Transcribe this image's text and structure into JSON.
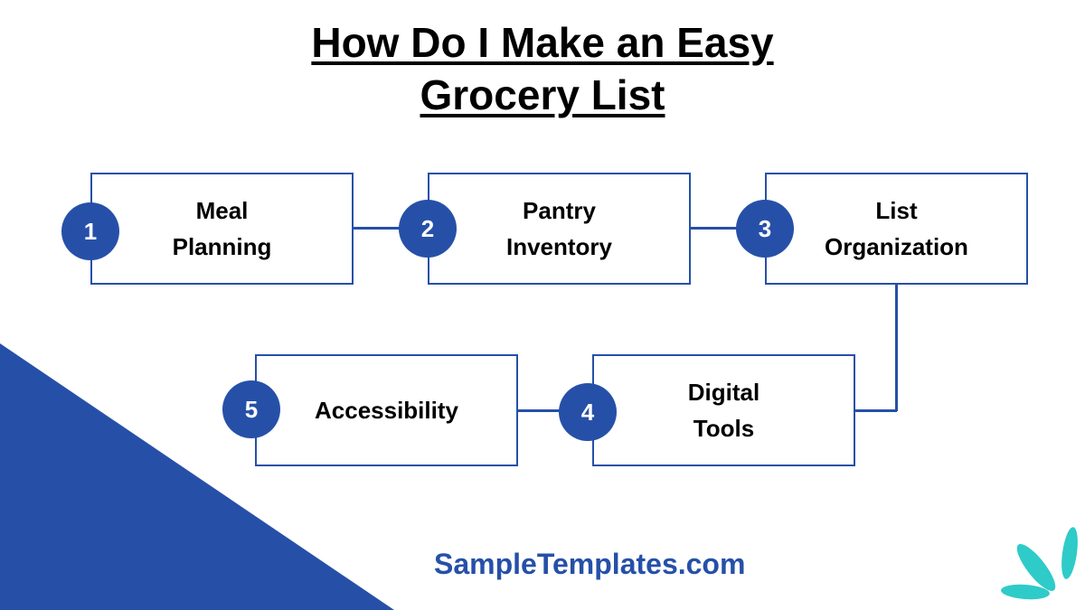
{
  "title": {
    "line1": "How Do I Make an Easy",
    "line2": "Grocery List"
  },
  "steps": [
    {
      "number": "1",
      "label_line1": "Meal",
      "label_line2": "Planning"
    },
    {
      "number": "2",
      "label_line1": "Pantry",
      "label_line2": "Inventory"
    },
    {
      "number": "3",
      "label_line1": "List",
      "label_line2": "Organization"
    },
    {
      "number": "4",
      "label_line1": "Digital",
      "label_line2": "Tools"
    },
    {
      "number": "5",
      "label_line1": "Accessibility",
      "label_line2": ""
    }
  ],
  "brand": {
    "text": "SampleTemplates.com"
  },
  "colors": {
    "primary": "#2650a8",
    "accent": "#2ecbc9",
    "text": "#000000",
    "background": "#ffffff"
  }
}
